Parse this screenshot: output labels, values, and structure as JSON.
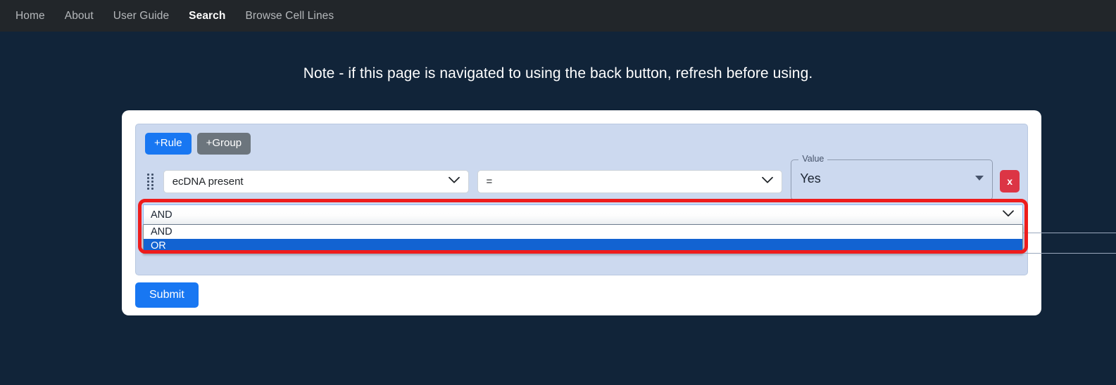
{
  "navbar": {
    "items": [
      {
        "label": "Home",
        "active": false
      },
      {
        "label": "About",
        "active": false
      },
      {
        "label": "User Guide",
        "active": false
      },
      {
        "label": "Search",
        "active": true
      },
      {
        "label": "Browse Cell Lines",
        "active": false
      }
    ]
  },
  "page": {
    "note": "Note - if this page is navigated to using the back button, refresh before using."
  },
  "query_builder": {
    "add_rule_label": "+Rule",
    "add_group_label": "+Group",
    "rule": {
      "field_value": "ecDNA present",
      "operator_value": "=",
      "value_label": "Value",
      "value_value": "Yes",
      "delete_label": "x"
    },
    "combinator": {
      "selected": "AND",
      "options": [
        "AND",
        "OR"
      ],
      "highlighted": "OR"
    }
  },
  "actions": {
    "submit_label": "Submit"
  },
  "colors": {
    "navbar_bg": "#22262a",
    "page_bg": "#112439",
    "card_bg": "#ffffff",
    "panel_bg": "#ccd9ef",
    "primary_blue": "#1877f2",
    "secondary_gray": "#6c757d",
    "danger_red": "#dc3545",
    "option_highlight": "#1263d2",
    "annotation_red": "#ee1c1c"
  }
}
